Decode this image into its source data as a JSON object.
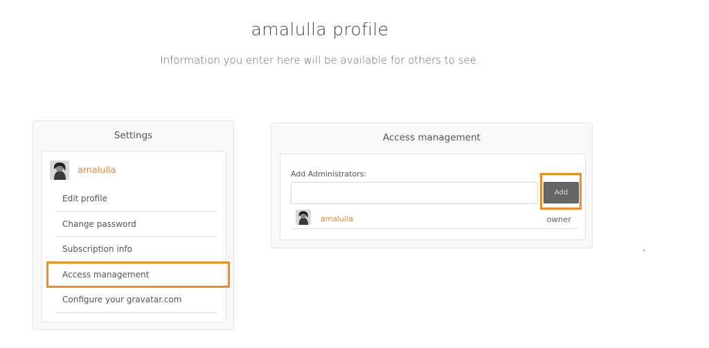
{
  "header": {
    "title": "amalulla profile",
    "subtitle": "Information you enter here will be available for others to see."
  },
  "settings": {
    "title": "Settings",
    "user": {
      "name": "amalulla",
      "avatar_icon": "user-avatar"
    },
    "menu": [
      {
        "label": "Edit profile"
      },
      {
        "label": "Change password"
      },
      {
        "label": "Subscription info"
      },
      {
        "label": "Access management",
        "selected": true
      },
      {
        "label": "Configure your gravatar.com"
      }
    ]
  },
  "access": {
    "title": "Access management",
    "add_label": "Add Administrators:",
    "input_value": "",
    "input_placeholder": "",
    "add_button": "Add",
    "administrators": [
      {
        "name": "amalulla",
        "role": "owner",
        "avatar_icon": "user-avatar"
      }
    ]
  },
  "colors": {
    "accent": "#e8883a",
    "highlight": "#f28b1e",
    "button": "#666666"
  }
}
